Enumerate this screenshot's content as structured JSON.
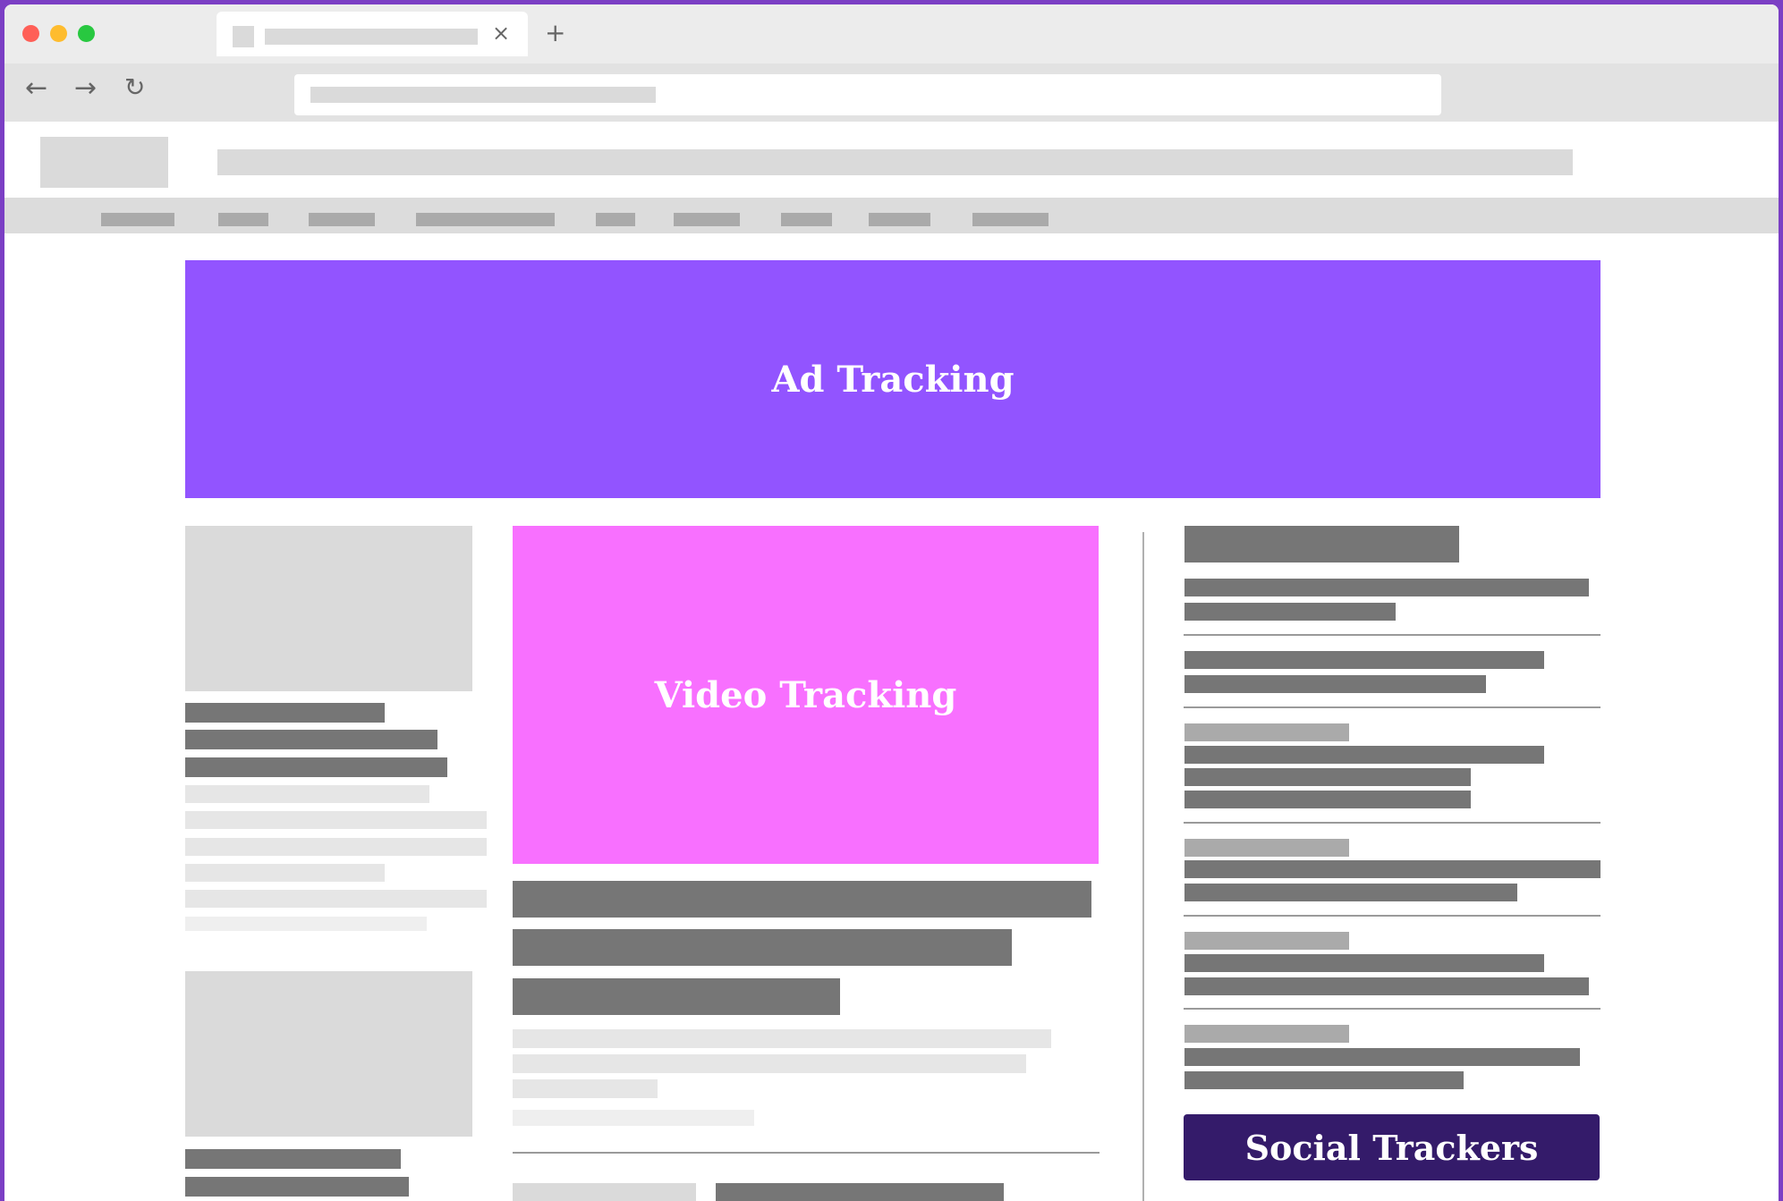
{
  "window": {
    "controls": {
      "close_color": "#ff5f57",
      "minimize_color": "#febc2e",
      "maximize_color": "#28c840"
    },
    "tab": {
      "close_icon": "close-icon",
      "new_tab_icon": "plus-icon"
    },
    "nav": {
      "back_icon": "arrow-left-icon",
      "forward_icon": "arrow-right-icon",
      "reload_icon": "reload-icon"
    }
  },
  "page": {
    "ad_block": {
      "label": "Ad Tracking",
      "color": "#9254ff"
    },
    "video_block": {
      "label": "Video Tracking",
      "color": "#f870ff"
    },
    "social_block": {
      "label": "Social Trackers",
      "color": "#341b6a"
    }
  },
  "icons": {
    "close": "×",
    "plus": "+",
    "back": "←",
    "forward": "→",
    "reload": "↻"
  }
}
